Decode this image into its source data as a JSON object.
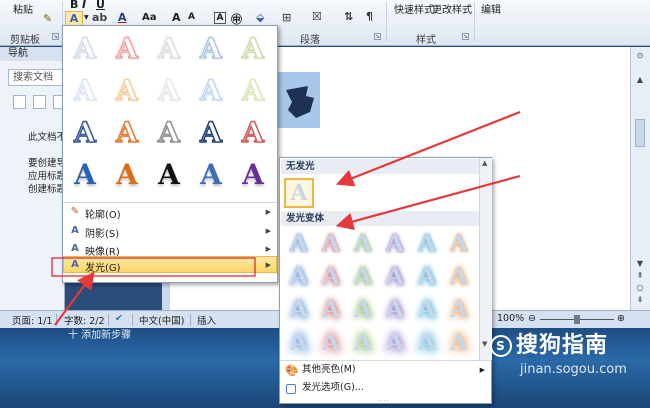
{
  "ribbon": {
    "clipboard_group": "剪贴板",
    "paste_label": "粘贴",
    "paragraph_group": "段落",
    "styles_group": "样式",
    "quick_styles": "快速样式",
    "change_styles": "更改样式",
    "edit_label": "编辑"
  },
  "nav_pane": {
    "title": "导航",
    "search_placeholder": "搜索文档",
    "lines": [
      "此文档不",
      "要创建导",
      "应用标题",
      "创建标题"
    ]
  },
  "status_bar": {
    "page": "页面: 1/1",
    "words": "字数: 2/2",
    "language": "中文(中国)",
    "insert_mode": "插入",
    "zoom": "100%"
  },
  "taskbar": {
    "text": "十 添加新步骤"
  },
  "effects_menu": {
    "gallery_letter": "A",
    "rows": [
      {
        "label": "轮廓(O)",
        "icon": "outline-icon"
      },
      {
        "label": "阴影(S)",
        "icon": "shadow-icon"
      },
      {
        "label": "映像(R)",
        "icon": "reflection-icon"
      },
      {
        "label": "发光(G)",
        "icon": "glow-icon"
      }
    ],
    "gallery_colors": [
      [
        "#cfd8e8",
        "#e99a9a",
        "#d9d9d9",
        "#a9c0e0",
        "#c7d9a8"
      ],
      [
        "#d7e2f4",
        "#f6c58f",
        "#e6e6e6",
        "#bcd3ee",
        "#d4e4b6"
      ],
      [
        "#3b5998",
        "#e8762c",
        "#909090",
        "#1f3f77",
        "#d05a5a"
      ],
      [
        "#2a62b8",
        "#de6b16",
        "#111111",
        "#3c6db8",
        "#6a2f97"
      ]
    ]
  },
  "glow_menu": {
    "no_glow_header": "无发光",
    "variants_header": "发光变体",
    "variant_colors": [
      "#6fa0dc",
      "#d77a7a",
      "#93c070",
      "#9a7ac8",
      "#53b8d8",
      "#f0a860"
    ],
    "more_colors": "其他亮色(M)",
    "glow_options": "发光选项(G)..."
  },
  "watermark": {
    "brand": "搜狗指南",
    "url": "jinan.sogou.com"
  },
  "colors": {
    "ribbon_bg": "#dfe7f2",
    "highlight": "#fcd666",
    "arrow": "#e5383b"
  }
}
